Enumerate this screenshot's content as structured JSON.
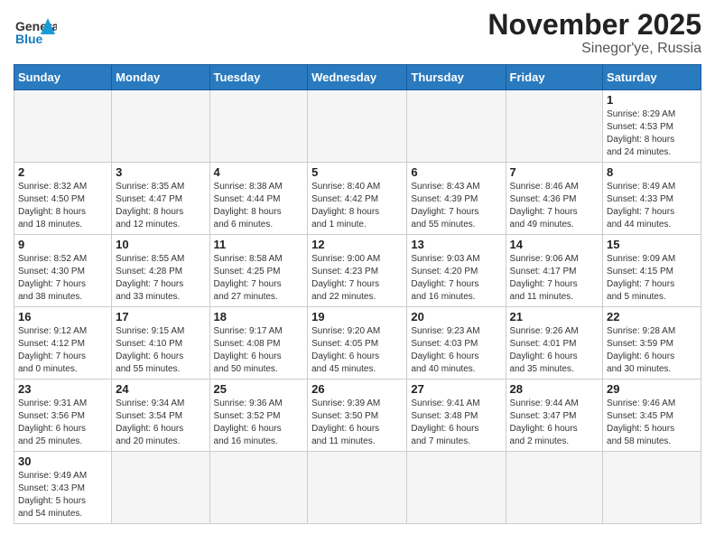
{
  "header": {
    "logo_general": "General",
    "logo_blue": "Blue",
    "month": "November 2025",
    "location": "Sinegor'ye, Russia"
  },
  "days_of_week": [
    "Sunday",
    "Monday",
    "Tuesday",
    "Wednesday",
    "Thursday",
    "Friday",
    "Saturday"
  ],
  "weeks": [
    [
      {
        "day": "",
        "info": ""
      },
      {
        "day": "",
        "info": ""
      },
      {
        "day": "",
        "info": ""
      },
      {
        "day": "",
        "info": ""
      },
      {
        "day": "",
        "info": ""
      },
      {
        "day": "",
        "info": ""
      },
      {
        "day": "1",
        "info": "Sunrise: 8:29 AM\nSunset: 4:53 PM\nDaylight: 8 hours\nand 24 minutes."
      }
    ],
    [
      {
        "day": "2",
        "info": "Sunrise: 8:32 AM\nSunset: 4:50 PM\nDaylight: 8 hours\nand 18 minutes."
      },
      {
        "day": "3",
        "info": "Sunrise: 8:35 AM\nSunset: 4:47 PM\nDaylight: 8 hours\nand 12 minutes."
      },
      {
        "day": "4",
        "info": "Sunrise: 8:38 AM\nSunset: 4:44 PM\nDaylight: 8 hours\nand 6 minutes."
      },
      {
        "day": "5",
        "info": "Sunrise: 8:40 AM\nSunset: 4:42 PM\nDaylight: 8 hours\nand 1 minute."
      },
      {
        "day": "6",
        "info": "Sunrise: 8:43 AM\nSunset: 4:39 PM\nDaylight: 7 hours\nand 55 minutes."
      },
      {
        "day": "7",
        "info": "Sunrise: 8:46 AM\nSunset: 4:36 PM\nDaylight: 7 hours\nand 49 minutes."
      },
      {
        "day": "8",
        "info": "Sunrise: 8:49 AM\nSunset: 4:33 PM\nDaylight: 7 hours\nand 44 minutes."
      }
    ],
    [
      {
        "day": "9",
        "info": "Sunrise: 8:52 AM\nSunset: 4:30 PM\nDaylight: 7 hours\nand 38 minutes."
      },
      {
        "day": "10",
        "info": "Sunrise: 8:55 AM\nSunset: 4:28 PM\nDaylight: 7 hours\nand 33 minutes."
      },
      {
        "day": "11",
        "info": "Sunrise: 8:58 AM\nSunset: 4:25 PM\nDaylight: 7 hours\nand 27 minutes."
      },
      {
        "day": "12",
        "info": "Sunrise: 9:00 AM\nSunset: 4:23 PM\nDaylight: 7 hours\nand 22 minutes."
      },
      {
        "day": "13",
        "info": "Sunrise: 9:03 AM\nSunset: 4:20 PM\nDaylight: 7 hours\nand 16 minutes."
      },
      {
        "day": "14",
        "info": "Sunrise: 9:06 AM\nSunset: 4:17 PM\nDaylight: 7 hours\nand 11 minutes."
      },
      {
        "day": "15",
        "info": "Sunrise: 9:09 AM\nSunset: 4:15 PM\nDaylight: 7 hours\nand 5 minutes."
      }
    ],
    [
      {
        "day": "16",
        "info": "Sunrise: 9:12 AM\nSunset: 4:12 PM\nDaylight: 7 hours\nand 0 minutes."
      },
      {
        "day": "17",
        "info": "Sunrise: 9:15 AM\nSunset: 4:10 PM\nDaylight: 6 hours\nand 55 minutes."
      },
      {
        "day": "18",
        "info": "Sunrise: 9:17 AM\nSunset: 4:08 PM\nDaylight: 6 hours\nand 50 minutes."
      },
      {
        "day": "19",
        "info": "Sunrise: 9:20 AM\nSunset: 4:05 PM\nDaylight: 6 hours\nand 45 minutes."
      },
      {
        "day": "20",
        "info": "Sunrise: 9:23 AM\nSunset: 4:03 PM\nDaylight: 6 hours\nand 40 minutes."
      },
      {
        "day": "21",
        "info": "Sunrise: 9:26 AM\nSunset: 4:01 PM\nDaylight: 6 hours\nand 35 minutes."
      },
      {
        "day": "22",
        "info": "Sunrise: 9:28 AM\nSunset: 3:59 PM\nDaylight: 6 hours\nand 30 minutes."
      }
    ],
    [
      {
        "day": "23",
        "info": "Sunrise: 9:31 AM\nSunset: 3:56 PM\nDaylight: 6 hours\nand 25 minutes."
      },
      {
        "day": "24",
        "info": "Sunrise: 9:34 AM\nSunset: 3:54 PM\nDaylight: 6 hours\nand 20 minutes."
      },
      {
        "day": "25",
        "info": "Sunrise: 9:36 AM\nSunset: 3:52 PM\nDaylight: 6 hours\nand 16 minutes."
      },
      {
        "day": "26",
        "info": "Sunrise: 9:39 AM\nSunset: 3:50 PM\nDaylight: 6 hours\nand 11 minutes."
      },
      {
        "day": "27",
        "info": "Sunrise: 9:41 AM\nSunset: 3:48 PM\nDaylight: 6 hours\nand 7 minutes."
      },
      {
        "day": "28",
        "info": "Sunrise: 9:44 AM\nSunset: 3:47 PM\nDaylight: 6 hours\nand 2 minutes."
      },
      {
        "day": "29",
        "info": "Sunrise: 9:46 AM\nSunset: 3:45 PM\nDaylight: 5 hours\nand 58 minutes."
      }
    ],
    [
      {
        "day": "30",
        "info": "Sunrise: 9:49 AM\nSunset: 3:43 PM\nDaylight: 5 hours\nand 54 minutes."
      },
      {
        "day": "",
        "info": ""
      },
      {
        "day": "",
        "info": ""
      },
      {
        "day": "",
        "info": ""
      },
      {
        "day": "",
        "info": ""
      },
      {
        "day": "",
        "info": ""
      },
      {
        "day": "",
        "info": ""
      }
    ]
  ]
}
